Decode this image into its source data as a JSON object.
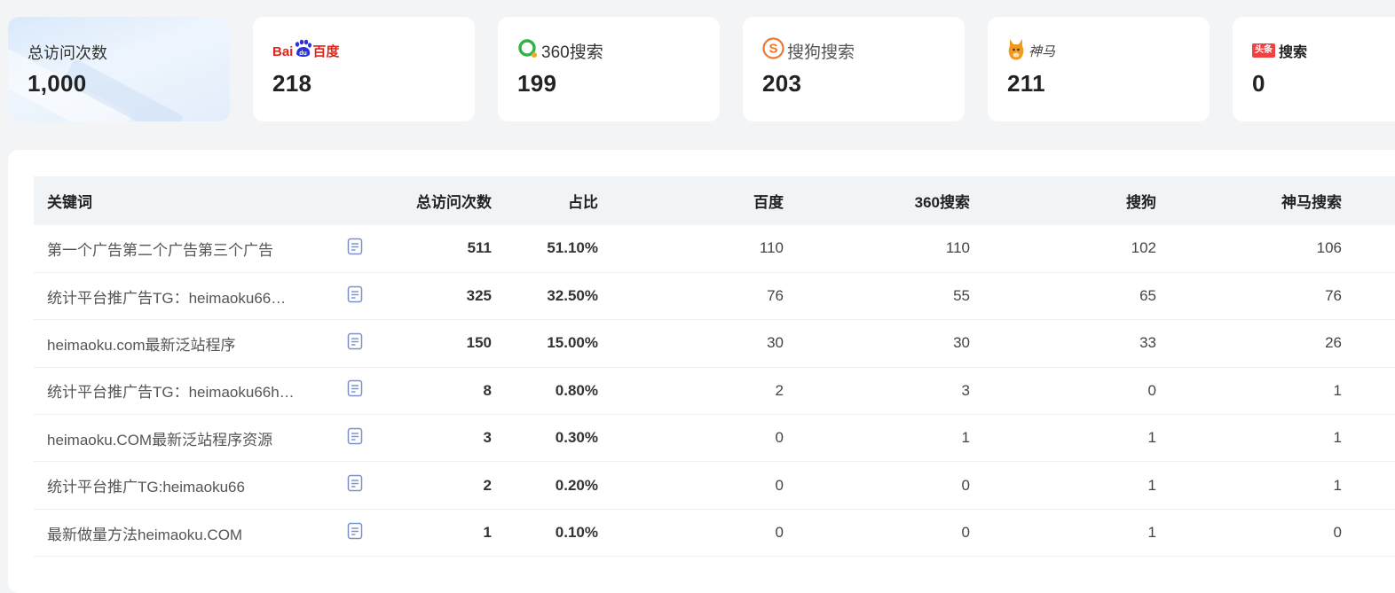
{
  "stats": {
    "total": {
      "label": "总访问次数",
      "value": "1,000"
    },
    "baidu": {
      "logo_text_1": "Bai",
      "logo_text_2": "du",
      "logo_text_3": "百度",
      "value": "218"
    },
    "so360": {
      "logo_text": "360搜索",
      "value": "199"
    },
    "sogou": {
      "logo_text": "搜狗搜索",
      "value": "203"
    },
    "shenma": {
      "logo_text": "神马",
      "value": "211"
    },
    "toutiao": {
      "logo_badge": "头条",
      "logo_text": "搜索",
      "value": "0"
    }
  },
  "table": {
    "headers": {
      "keyword": "关键词",
      "total": "总访问次数",
      "ratio": "占比",
      "baidu": "百度",
      "so360": "360搜索",
      "sogou": "搜狗",
      "shenma": "神马搜索"
    },
    "rows": [
      {
        "keyword": "第一个广告第二个广告第三个广告",
        "total": "511",
        "ratio": "51.10%",
        "baidu": "110",
        "so360": "110",
        "sogou": "102",
        "shenma": "106"
      },
      {
        "keyword": "统计平台推广告TG：heimaoku66…",
        "total": "325",
        "ratio": "32.50%",
        "baidu": "76",
        "so360": "55",
        "sogou": "65",
        "shenma": "76"
      },
      {
        "keyword": "heimaoku.com最新泛站程序",
        "total": "150",
        "ratio": "15.00%",
        "baidu": "30",
        "so360": "30",
        "sogou": "33",
        "shenma": "26"
      },
      {
        "keyword": "统计平台推广告TG：heimaoku66h…",
        "total": "8",
        "ratio": "0.80%",
        "baidu": "2",
        "so360": "3",
        "sogou": "0",
        "shenma": "1"
      },
      {
        "keyword": "heimaoku.COM最新泛站程序资源",
        "total": "3",
        "ratio": "0.30%",
        "baidu": "0",
        "so360": "1",
        "sogou": "1",
        "shenma": "1"
      },
      {
        "keyword": "统计平台推广TG:heimaoku66",
        "total": "2",
        "ratio": "0.20%",
        "baidu": "0",
        "so360": "0",
        "sogou": "1",
        "shenma": "1"
      },
      {
        "keyword": "最新做量方法heimaoku.COM",
        "total": "1",
        "ratio": "0.10%",
        "baidu": "0",
        "so360": "0",
        "sogou": "1",
        "shenma": "0"
      }
    ]
  },
  "icons": {
    "row_action": "document-icon"
  },
  "colors": {
    "baidu_red": "#e1251b",
    "baidu_blue": "#2932e1",
    "so360_green": "#2fb344",
    "so360_orange": "#f5a623",
    "sogou_orange": "#f0762e",
    "toutiao_red": "#f04142",
    "icon_blue": "#7b8fc9"
  }
}
